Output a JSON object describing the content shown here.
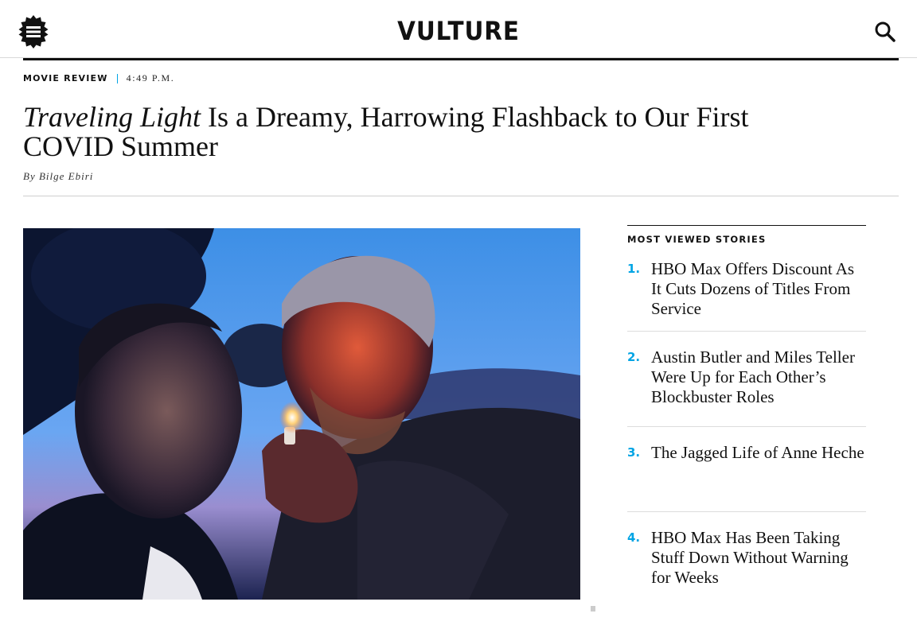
{
  "header": {
    "logo": "VULTURE",
    "menu_icon": "hamburger-icon",
    "search_icon": "search-icon"
  },
  "article": {
    "rubric": "MOVIE REVIEW",
    "time": "4:49 P.M.",
    "headline_italic": "Traveling Light",
    "headline_rest": " Is a Dreamy, Harrowing Flashback to Our First COVID Summer",
    "byline": "By Bilge Ebiri"
  },
  "sidebar": {
    "title": "MOST VIEWED STORIES",
    "stories": [
      {
        "num": "1.",
        "title": "HBO Max Offers Discount As It Cuts Dozens of Titles From Service"
      },
      {
        "num": "2.",
        "title": "Austin Butler and Miles Teller Were Up for Each Other’s Blockbuster Roles"
      },
      {
        "num": "3.",
        "title": "The Jagged Life of Anne Heche"
      },
      {
        "num": "4.",
        "title": "HBO Max Has Been Taking Stuff Down Without Warning for Weeks"
      }
    ]
  },
  "colors": {
    "accent": "#00a4e4",
    "text": "#111111",
    "rule": "#dcdcdc"
  }
}
